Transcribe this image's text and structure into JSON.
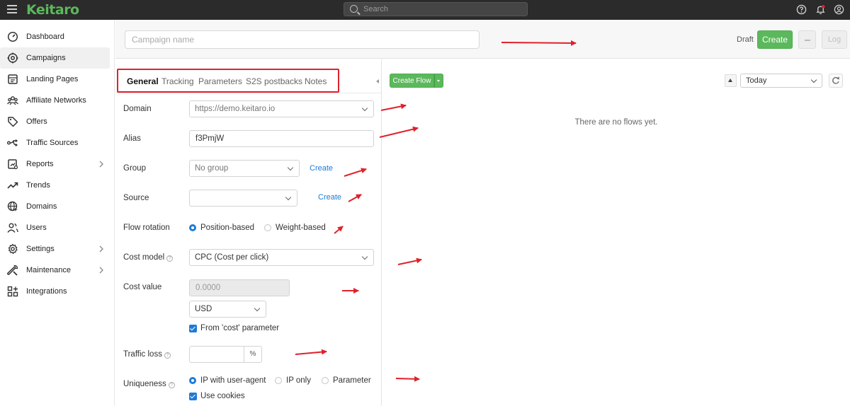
{
  "app": {
    "logo": "Keitaro"
  },
  "search": {
    "placeholder": "Search"
  },
  "sidebar": {
    "items": [
      {
        "label": "Dashboard",
        "icon": "dashboard-icon",
        "active": false,
        "chevron": false
      },
      {
        "label": "Campaigns",
        "icon": "campaigns-icon",
        "active": true,
        "chevron": false
      },
      {
        "label": "Landing Pages",
        "icon": "landing-pages-icon",
        "active": false,
        "chevron": false
      },
      {
        "label": "Affiliate Networks",
        "icon": "affiliate-networks-icon",
        "active": false,
        "chevron": false
      },
      {
        "label": "Offers",
        "icon": "offers-icon",
        "active": false,
        "chevron": false
      },
      {
        "label": "Traffic Sources",
        "icon": "traffic-sources-icon",
        "active": false,
        "chevron": false
      },
      {
        "label": "Reports",
        "icon": "reports-icon",
        "active": false,
        "chevron": true
      },
      {
        "label": "Trends",
        "icon": "trends-icon",
        "active": false,
        "chevron": false
      },
      {
        "label": "Domains",
        "icon": "domains-icon",
        "active": false,
        "chevron": false
      },
      {
        "label": "Users",
        "icon": "users-icon",
        "active": false,
        "chevron": false
      },
      {
        "label": "Settings",
        "icon": "settings-icon",
        "active": false,
        "chevron": true
      },
      {
        "label": "Maintenance",
        "icon": "maintenance-icon",
        "active": false,
        "chevron": true
      },
      {
        "label": "Integrations",
        "icon": "integrations-icon",
        "active": false,
        "chevron": false
      }
    ]
  },
  "header": {
    "campaign_placeholder": "Campaign name",
    "status": "Draft",
    "create_label": "Create",
    "log_label": "Log"
  },
  "tabs": [
    "General",
    "Tracking",
    "Parameters",
    "S2S postbacks",
    "Notes"
  ],
  "form": {
    "domain": {
      "label": "Domain",
      "value": "https://demo.keitaro.io"
    },
    "alias": {
      "label": "Alias",
      "value": "f3PmjW"
    },
    "group": {
      "label": "Group",
      "value": "No group",
      "create": "Create"
    },
    "source": {
      "label": "Source",
      "value": "",
      "create": "Create"
    },
    "flow_rotation": {
      "label": "Flow rotation",
      "options": [
        "Position-based",
        "Weight-based"
      ],
      "selected": "Position-based"
    },
    "cost_model": {
      "label": "Cost model",
      "value": "CPC (Cost per click)"
    },
    "cost_value": {
      "label": "Cost value",
      "placeholder": "0.0000",
      "currency": "USD",
      "from_cost_param": "From 'cost' parameter"
    },
    "traffic_loss": {
      "label": "Traffic loss",
      "unit": "%"
    },
    "uniqueness": {
      "label": "Uniqueness",
      "options": [
        "IP with user-agent",
        "IP only",
        "Parameter"
      ],
      "selected": "IP with user-agent",
      "use_cookies": "Use cookies"
    }
  },
  "flows": {
    "create_flow_label": "Create Flow",
    "date_range": "Today",
    "empty_message": "There are no flows yet."
  },
  "colors": {
    "topbar": "#2b2b2b",
    "brand_green": "#5cb85c",
    "link_blue": "#1e7bd6",
    "annotation_red": "#e0212b"
  }
}
